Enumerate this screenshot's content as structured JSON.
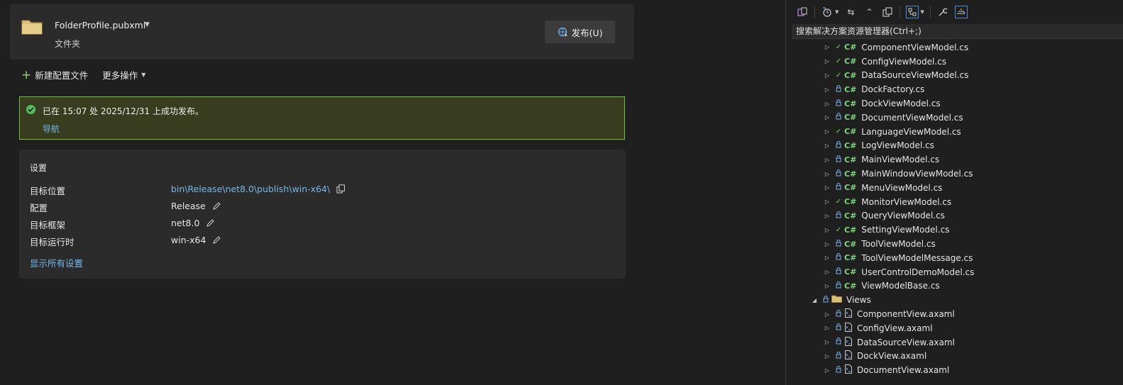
{
  "publish": {
    "profile_name": "FolderProfile.pubxml",
    "profile_type": "文件夹",
    "publish_button": "发布(U)"
  },
  "actions": {
    "new_profile": "新建配置文件",
    "more_actions": "更多操作"
  },
  "banner": {
    "message": "已在 15:07 处 2025/12/31 上成功发布。",
    "link": "导航"
  },
  "settings": {
    "title": "设置",
    "rows": [
      {
        "label": "目标位置",
        "value": "bin\\Release\\net8.0\\publish\\win-x64\\"
      },
      {
        "label": "配置",
        "value": "Release"
      },
      {
        "label": "目标框架",
        "value": "net8.0"
      },
      {
        "label": "目标运行时",
        "value": "win-x64"
      }
    ],
    "show_all": "显示所有设置"
  },
  "solution_explorer": {
    "search_placeholder": "搜索解决方案资源管理器(Ctrl+;)",
    "items": [
      {
        "name": "ComponentViewModel.cs",
        "status": "check",
        "kind": "cs"
      },
      {
        "name": "ConfigViewModel.cs",
        "status": "check",
        "kind": "cs"
      },
      {
        "name": "DataSourceViewModel.cs",
        "status": "check",
        "kind": "cs"
      },
      {
        "name": "DockFactory.cs",
        "status": "lock",
        "kind": "cs"
      },
      {
        "name": "DockViewModel.cs",
        "status": "lock",
        "kind": "cs"
      },
      {
        "name": "DocumentViewModel.cs",
        "status": "lock",
        "kind": "cs"
      },
      {
        "name": "LanguageViewModel.cs",
        "status": "check",
        "kind": "cs"
      },
      {
        "name": "LogViewModel.cs",
        "status": "lock",
        "kind": "cs"
      },
      {
        "name": "MainViewModel.cs",
        "status": "lock",
        "kind": "cs"
      },
      {
        "name": "MainWindowViewModel.cs",
        "status": "lock",
        "kind": "cs"
      },
      {
        "name": "MenuViewModel.cs",
        "status": "lock",
        "kind": "cs"
      },
      {
        "name": "MonitorViewModel.cs",
        "status": "check",
        "kind": "cs"
      },
      {
        "name": "QueryViewModel.cs",
        "status": "lock",
        "kind": "cs"
      },
      {
        "name": "SettingViewModel.cs",
        "status": "check",
        "kind": "cs"
      },
      {
        "name": "ToolViewModel.cs",
        "status": "lock",
        "kind": "cs"
      },
      {
        "name": "ToolViewModelMessage.cs",
        "status": "lock",
        "kind": "cs"
      },
      {
        "name": "UserControlDemoModel.cs",
        "status": "lock",
        "kind": "cs"
      },
      {
        "name": "ViewModelBase.cs",
        "status": "lock",
        "kind": "cs"
      },
      {
        "name": "Views",
        "status": "lock",
        "kind": "folder"
      },
      {
        "name": "ComponentView.axaml",
        "status": "lock",
        "kind": "axaml"
      },
      {
        "name": "ConfigView.axaml",
        "status": "lock",
        "kind": "axaml"
      },
      {
        "name": "DataSourceView.axaml",
        "status": "lock",
        "kind": "axaml"
      },
      {
        "name": "DockView.axaml",
        "status": "lock",
        "kind": "axaml"
      },
      {
        "name": "DocumentView.axaml",
        "status": "lock",
        "kind": "axaml"
      }
    ]
  },
  "colors": {
    "accent_link": "#75b8e8",
    "success_border": "#6fbf40",
    "success_bg": "#393d1f",
    "cs_icon": "#7fd87f"
  }
}
